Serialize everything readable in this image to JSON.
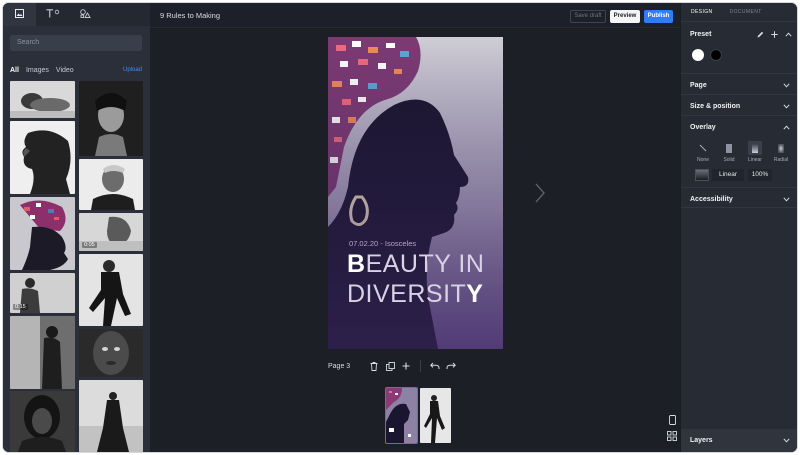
{
  "left_panel": {
    "tabs": [
      {
        "icon": "image-icon"
      },
      {
        "icon": "text-icon"
      },
      {
        "icon": "shapes-icon"
      }
    ],
    "search_placeholder": "Search",
    "filters": [
      "All",
      "Images",
      "Video"
    ],
    "upload_label": "Upload",
    "media": [
      {
        "icon": "photo-thumbnail",
        "duration": ""
      },
      {
        "icon": "photo-thumbnail",
        "duration": ""
      },
      {
        "icon": "photo-thumbnail",
        "duration": ""
      },
      {
        "icon": "photo-thumbnail",
        "duration": ""
      },
      {
        "icon": "photo-thumbnail",
        "duration": ""
      },
      {
        "icon": "video-thumbnail",
        "duration": "0:05"
      },
      {
        "icon": "video-thumbnail",
        "duration": "0:15"
      },
      {
        "icon": "photo-thumbnail",
        "duration": ""
      },
      {
        "icon": "photo-thumbnail",
        "duration": ""
      },
      {
        "icon": "photo-thumbnail",
        "duration": ""
      },
      {
        "icon": "photo-thumbnail",
        "duration": ""
      },
      {
        "icon": "photo-thumbnail",
        "duration": ""
      }
    ]
  },
  "topbar": {
    "title": "9 Rules to Making",
    "save_draft": "Save draft",
    "preview": "Preview",
    "publish": "Publish"
  },
  "canvas": {
    "story": {
      "date": "07.02.20 - Isosceles",
      "line1_first": "B",
      "line1_rest": "EAUTY IN",
      "line2_rest": "DIVERSIT",
      "line2_last": "Y"
    },
    "page_label": "Page 3",
    "page_tools": [
      "trash-icon",
      "duplicate-icon",
      "plus-icon",
      "undo-icon",
      "redo-icon"
    ],
    "next_icon": "chevron-right-icon"
  },
  "right_panel": {
    "tabs": [
      "DESIGN",
      "DOCUMENT"
    ],
    "preset": {
      "title": "Preset",
      "swatches": [
        "#ffffff",
        "#000000"
      ]
    },
    "page_title": "Page",
    "size_title": "Size & position",
    "overlay": {
      "title": "Overlay",
      "options": [
        "None",
        "Solid",
        "Linear",
        "Radial"
      ],
      "selected": "Linear",
      "type_value": "Linear",
      "opacity_value": "100%"
    },
    "accessibility_title": "Accessibility",
    "layers_title": "Layers"
  },
  "colors": {
    "accent": "#2f7cf6",
    "panel": "#272b34",
    "canvas_bg": "#1c1f26"
  }
}
